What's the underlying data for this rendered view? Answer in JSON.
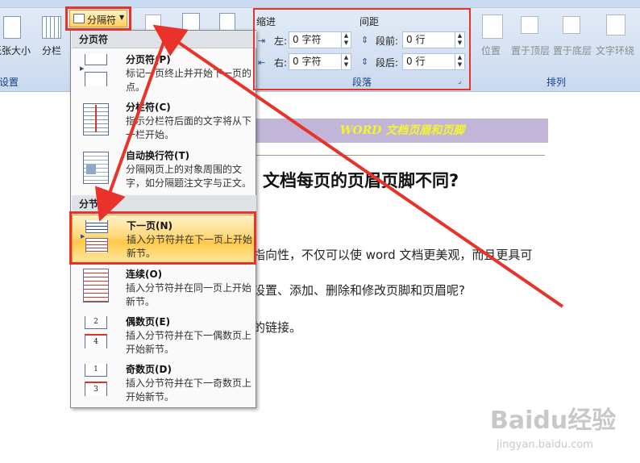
{
  "ribbon": {
    "page_setup": {
      "paper_size_label": "纸张大小",
      "columns_label": "分栏",
      "group_label": "设置"
    },
    "breaks_button_label": "分隔符",
    "paragraph": {
      "indent_label": "缩进",
      "indent_left_label": "左:",
      "indent_left_value": "0 字符",
      "indent_right_label": "右:",
      "indent_right_value": "0 字符",
      "spacing_label": "间距",
      "spacing_before_label": "段前:",
      "spacing_before_value": "0 行",
      "spacing_after_label": "段后:",
      "spacing_after_value": "0 行",
      "group_label": "段落"
    },
    "arrange": {
      "position_label": "位置",
      "bring_to_front_label": "置于顶层",
      "send_to_back_label": "置于底层",
      "text_wrap_label": "文字环绕",
      "group_label": "排列"
    }
  },
  "menu": {
    "page_breaks_header": "分页符",
    "section_breaks_header": "分节符",
    "items": [
      {
        "title": "分页符(P)",
        "desc": "标记一页终止并开始下一页的点。"
      },
      {
        "title": "分栏符(C)",
        "desc": "指示分栏符后面的文字将从下一栏开始。"
      },
      {
        "title": "自动换行符(T)",
        "desc": "分隔网页上的对象周围的文字，如分隔题注文字与正文。"
      },
      {
        "title": "下一页(N)",
        "desc": "插入分节符并在下一页上开始新节。"
      },
      {
        "title": "连续(O)",
        "desc": "插入分节符并在同一页上开始新节。"
      },
      {
        "title": "偶数页(E)",
        "desc": "插入分节符并在下一偶数页上开始新节。"
      },
      {
        "title": "奇数页(D)",
        "desc": "插入分节符并在下一奇数页上开始新节。"
      }
    ],
    "even_page_icon_number_top": "2",
    "even_page_icon_number_bottom": "4",
    "odd_page_icon_number_top": "1",
    "odd_page_icon_number_bottom": "3"
  },
  "document": {
    "header_text": "WORD 文档页眉和页脚",
    "title": "文档每页的页眉页脚不同?",
    "para1": "指向性，不仅可以使 word 文档更美观，而且更具可",
    "para2": "设置、添加、删除和修改页脚和页眉呢?",
    "para3": "的链接。"
  },
  "watermark": {
    "brand": "Baidu经验",
    "url": "jingyan.baidu.com"
  },
  "colors": {
    "annotation_red": "#e8322a",
    "highlight_gold": "#ffd87a",
    "header_purple": "#c1b6d8",
    "header_text_yellow": "#f5f52a"
  }
}
